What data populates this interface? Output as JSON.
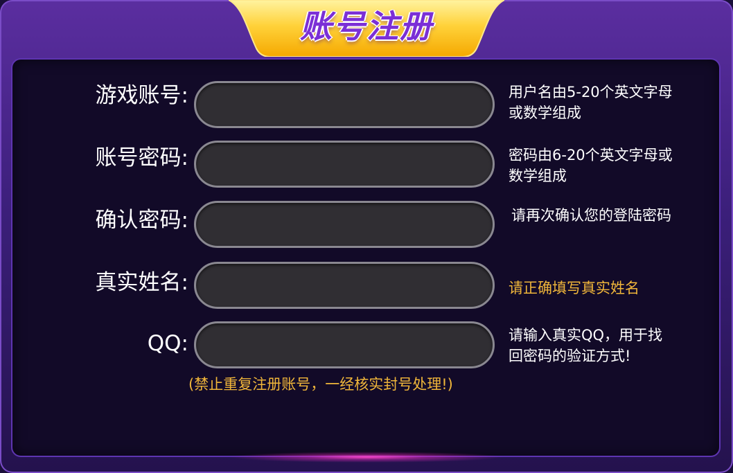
{
  "dialog": {
    "title": "账号注册",
    "fields": [
      {
        "label": "游戏账号:",
        "value": "",
        "hint": "用户名由5-20个英文字母或数学组成"
      },
      {
        "label": "账号密码:",
        "value": "",
        "hint": "密码由6-20个英文字母或数学组成"
      },
      {
        "label": "确认密码:",
        "value": "",
        "hint": "请再次确认您的登陆密码"
      },
      {
        "label": "真实姓名:",
        "value": "",
        "hint": "请正确填写真实姓名"
      },
      {
        "label": "QQ:",
        "value": "",
        "hint": "请输入真实QQ，用于找回密码的验证方式!"
      }
    ],
    "warning": "(禁止重复注册账号，一经核实封号处理!)"
  },
  "colors": {
    "frame": "#3b1f7a",
    "panel": "#120a28",
    "title_tab": "#f7c22a",
    "title_text": "#7b2fd6",
    "hint_highlight": "#f0b63a",
    "field_bg": "#302e33",
    "field_border": "#8a8891"
  }
}
